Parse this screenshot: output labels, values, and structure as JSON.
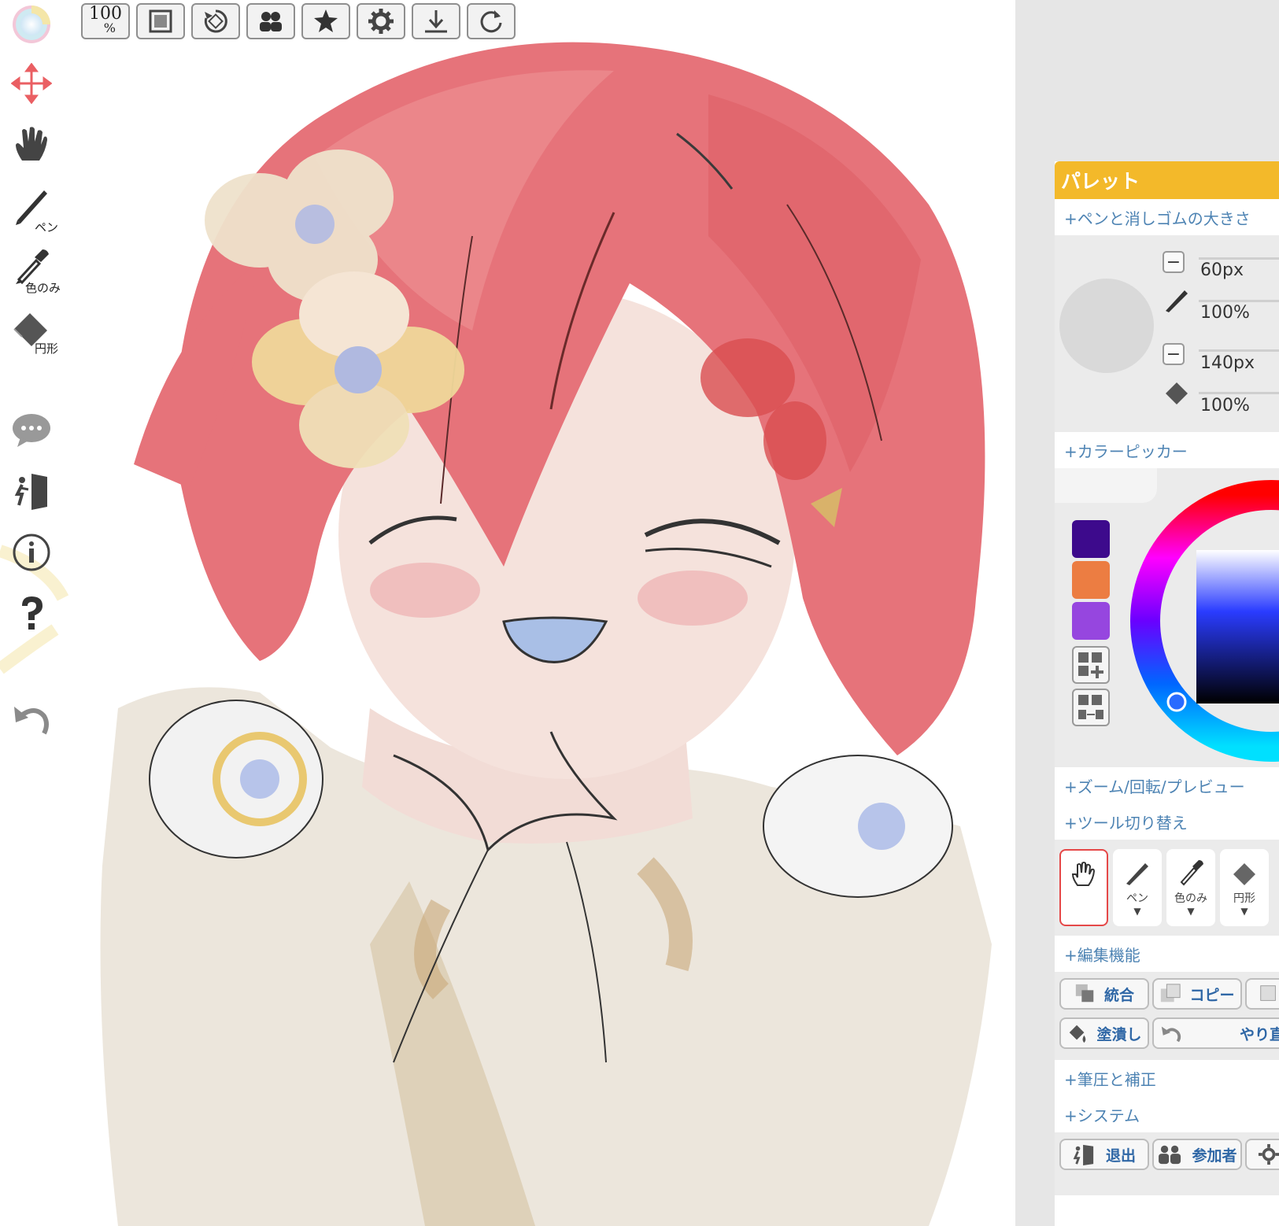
{
  "topbar": {
    "zoom_value": "100",
    "zoom_unit": "%"
  },
  "left_tools": {
    "pen_label": "ペン",
    "eyedropper_label": "色のみ",
    "eraser_label": "円形"
  },
  "panel": {
    "title": "パレット",
    "brush_section": {
      "heading": "+ペンと消しゴムの大きさ",
      "pen_size": "60px",
      "pen_opacity": "100%",
      "eraser_size": "140px",
      "eraser_opacity": "100%"
    },
    "color_picker": {
      "heading": "+カラーピッカー",
      "swatches": [
        "#3d0a8c",
        "#ec7d42",
        "#9646df"
      ]
    },
    "zoom_section": {
      "heading": "+ズーム/回転/プレビュー"
    },
    "tool_switch": {
      "heading": "+ツール切り替え",
      "tools": [
        {
          "label": ""
        },
        {
          "label": "ペン"
        },
        {
          "label": "色のみ"
        },
        {
          "label": "円形"
        }
      ]
    },
    "edit_section": {
      "heading": "+編集機能",
      "merge_label": "統合",
      "copy_label": "コピー",
      "fill_label": "塗潰し",
      "redo_label": "やり直"
    },
    "pressure_section": {
      "heading": "+筆圧と補正"
    },
    "system_section": {
      "heading": "+システム",
      "exit_label": "退出",
      "participants_label": "参加者"
    }
  },
  "colors": {
    "header": "#f3b92a",
    "link": "#4d83b3",
    "accent_red": "#e54848"
  }
}
